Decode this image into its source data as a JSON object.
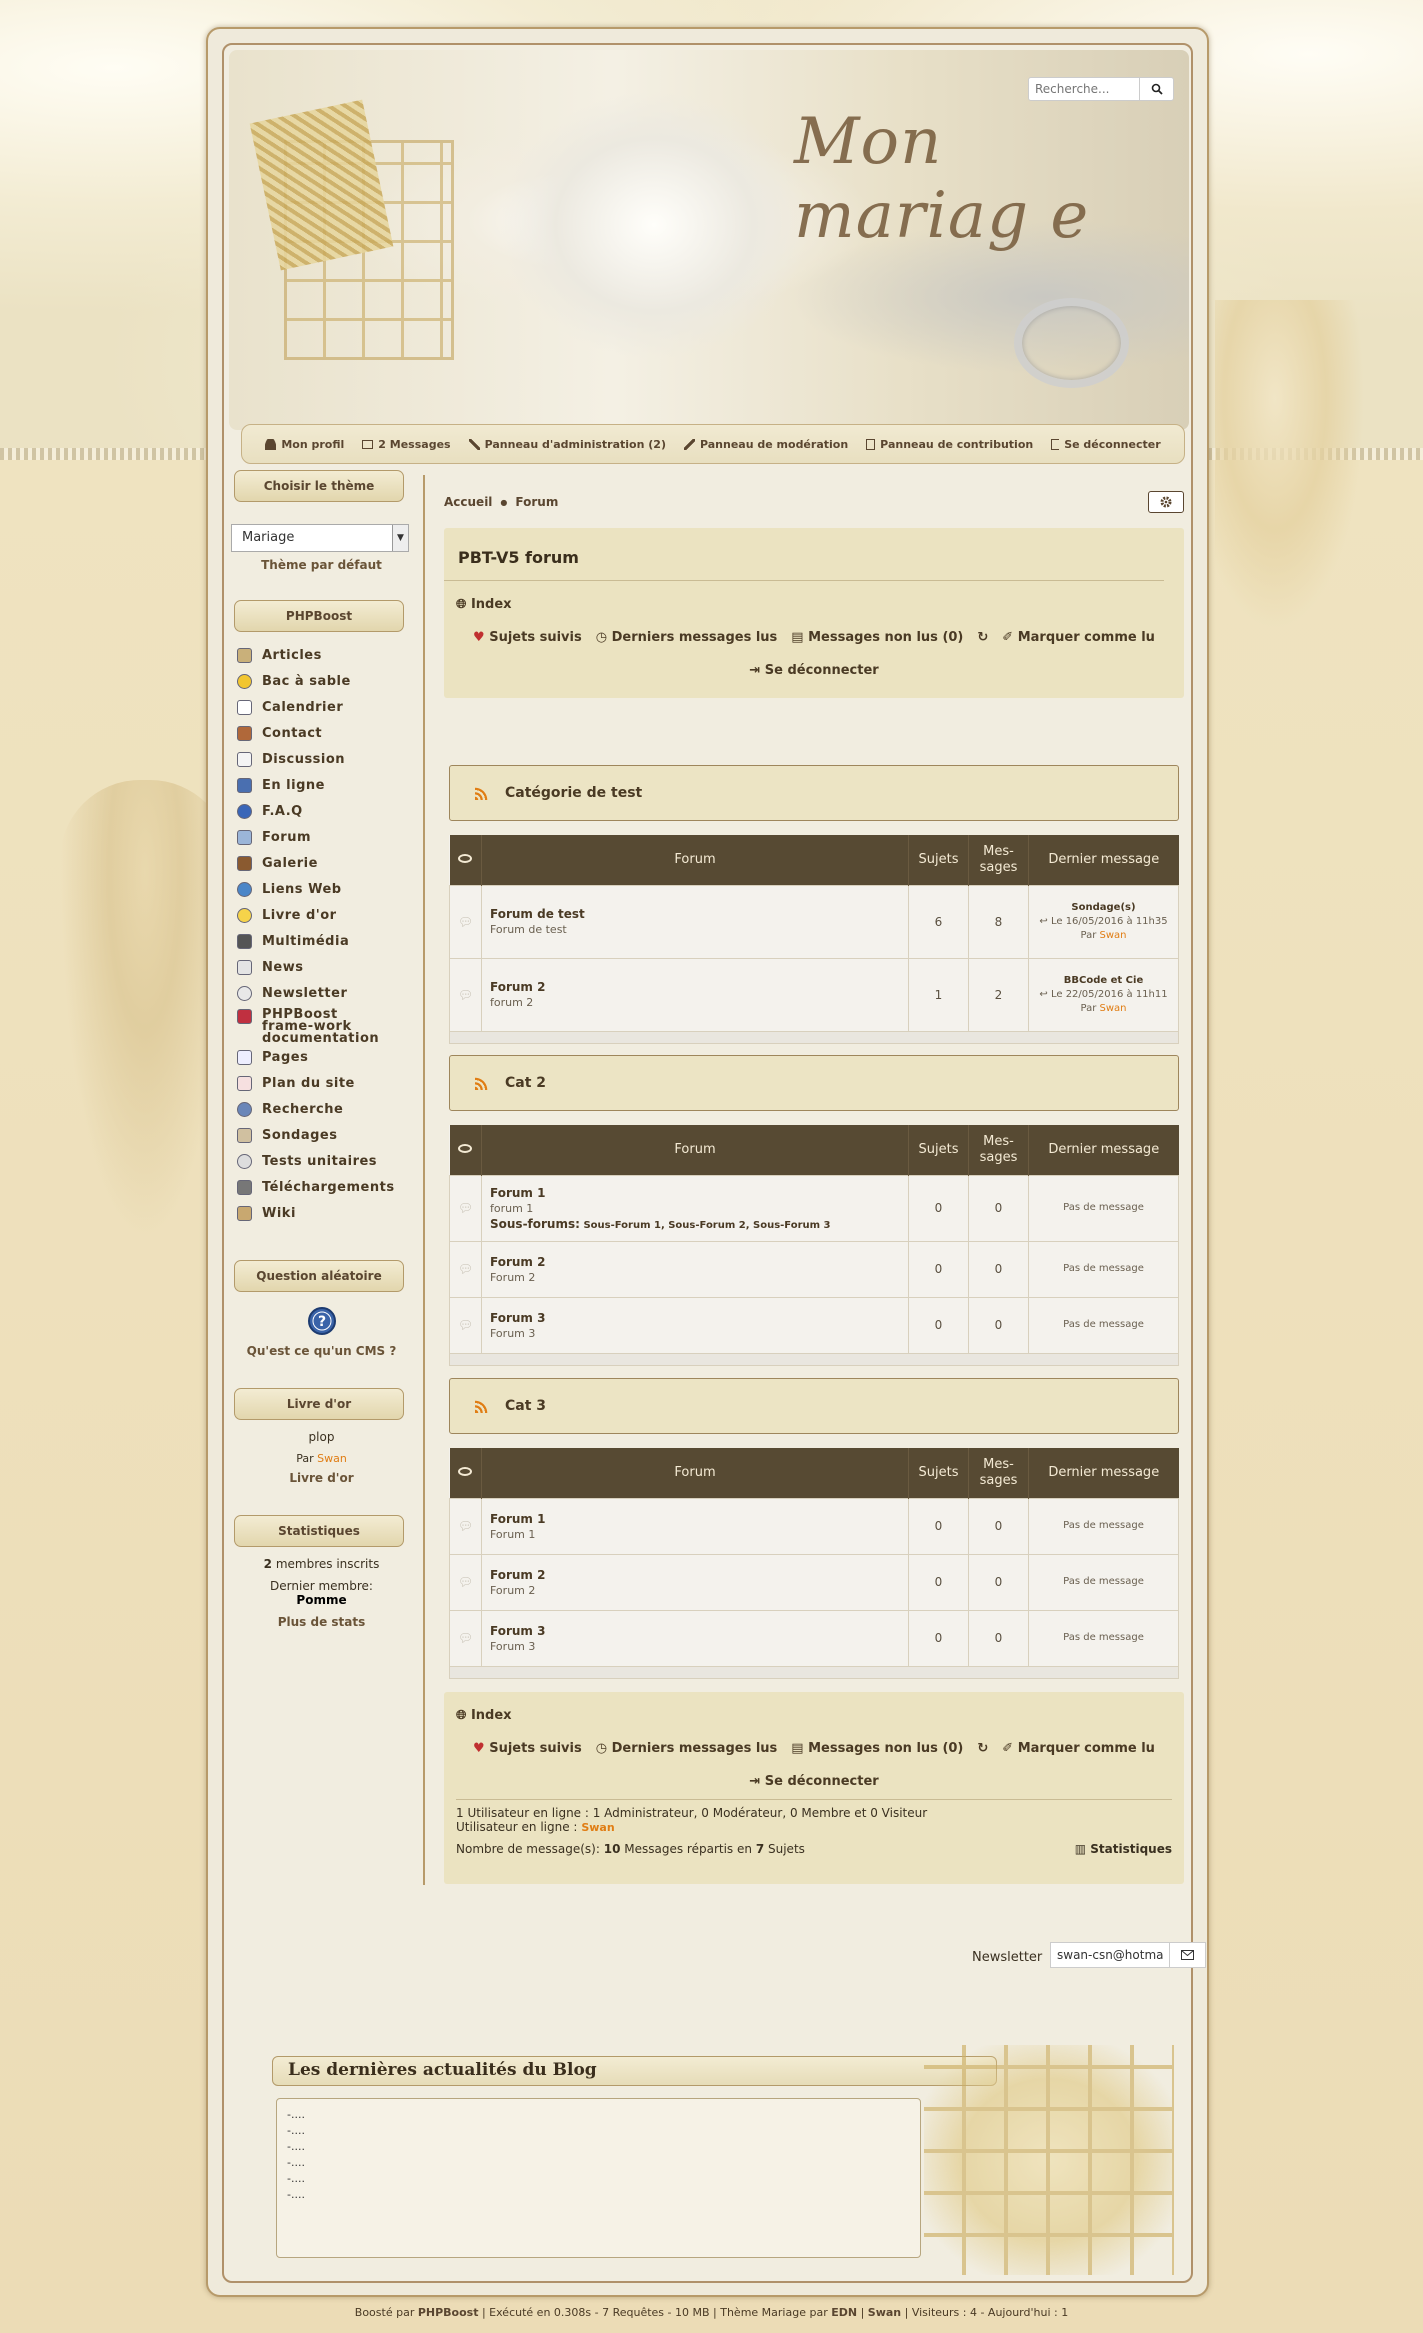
{
  "header": {
    "logo_text": "Mon mariag e",
    "search_placeholder": "Recherche..."
  },
  "userbar": [
    "Mon profil",
    "2 Messages",
    "Panneau d'administration (2)",
    "Panneau de modération",
    "Panneau de contribution",
    "Se déconnecter"
  ],
  "sidebar": {
    "theme_title": "Choisir le thème",
    "theme_selected": "Mariage",
    "theme_default": "Thème par défaut",
    "menu_title": "PHPBoost",
    "menu": [
      "Articles",
      "Bac à sable",
      "Calendrier",
      "Contact",
      "Discussion",
      "En ligne",
      "F.A.Q",
      "Forum",
      "Galerie",
      "Liens Web",
      "Livre d'or",
      "Multimédia",
      "News",
      "Newsletter",
      "PHPBoost frame-work documentation",
      "Pages",
      "Plan du site",
      "Recherche",
      "Sondages",
      "Tests unitaires",
      "Téléchargements",
      "Wiki"
    ],
    "question_title": "Question aléatoire",
    "question_text": "Qu'est ce qu'un CMS ?",
    "guestbook_title": "Livre d'or",
    "guestbook_msg": "plop",
    "guestbook_by": "Par",
    "guestbook_author": "Swan",
    "guestbook_link": "Livre d'or",
    "stats_title": "Statistiques",
    "stats_members_count": "2",
    "stats_members_label": "membres inscrits",
    "stats_last_label": "Dernier membre:",
    "stats_last_member": "Pomme",
    "stats_more": "Plus de stats"
  },
  "breadcrumb": [
    "Accueil",
    "Forum"
  ],
  "forum": {
    "title": "PBT-V5 forum",
    "index_label": "Index",
    "links": [
      "Sujets suivis",
      "Derniers messages lus",
      "Messages non lus (0)",
      "Marquer comme lu"
    ],
    "logout": "Se déconnecter",
    "col_forum": "Forum",
    "col_topics": "Sujets",
    "col_msgs_1": "Mes-",
    "col_msgs_2": "sages",
    "col_last": "Dernier message",
    "categories": [
      {
        "name": "Catégorie de test",
        "forums": [
          {
            "name": "Forum de test",
            "desc": "Forum de test",
            "topics": "6",
            "msgs": "8",
            "last_title": "Sondage(s)",
            "last_date": "Le 16/05/2016 à 11h35",
            "last_by": "Par",
            "last_user": "Swan"
          },
          {
            "name": "Forum 2",
            "desc": "forum 2",
            "topics": "1",
            "msgs": "2",
            "last_title": "BBCode et Cie",
            "last_date": "Le 22/05/2016 à 11h11",
            "last_by": "Par",
            "last_user": "Swan"
          }
        ]
      },
      {
        "name": "Cat 2",
        "forums": [
          {
            "name": "Forum 1",
            "desc": "forum 1",
            "sub_label": "Sous-forums:",
            "sub_list": "Sous-Forum 1, Sous-Forum 2, Sous-Forum 3",
            "topics": "0",
            "msgs": "0",
            "last": "Pas de message"
          },
          {
            "name": "Forum 2",
            "desc": "Forum 2",
            "topics": "0",
            "msgs": "0",
            "last": "Pas de message"
          },
          {
            "name": "Forum 3",
            "desc": "Forum 3",
            "topics": "0",
            "msgs": "0",
            "last": "Pas de message"
          }
        ]
      },
      {
        "name": "Cat 3",
        "forums": [
          {
            "name": "Forum 1",
            "desc": "Forum 1",
            "topics": "0",
            "msgs": "0",
            "last": "Pas de message"
          },
          {
            "name": "Forum 2",
            "desc": "Forum 2",
            "topics": "0",
            "msgs": "0",
            "last": "Pas de message"
          },
          {
            "name": "Forum 3",
            "desc": "Forum 3",
            "topics": "0",
            "msgs": "0",
            "last": "Pas de message"
          }
        ]
      }
    ],
    "online_line": "1 Utilisateur en ligne : 1 Administrateur, 0 Modérateur, 0 Membre et 0 Visiteur",
    "online_users_label": "Utilisateur en ligne :",
    "online_user": "Swan",
    "msgs_prefix": "Nombre de message(s):",
    "msgs_count": "10",
    "msgs_mid": "Messages répartis en",
    "topics_count": "7",
    "msgs_suffix": "Sujets",
    "stats_link": "Statistiques"
  },
  "newsletter": {
    "label": "Newsletter",
    "value": "swan-csn@hotma"
  },
  "blog": {
    "title": "Les dernières actualités du Blog",
    "items": [
      "-....",
      "-....",
      "-....",
      "-....",
      "-....",
      "-...."
    ]
  },
  "footer": {
    "powered": "Boosté par",
    "phpboost": "PHPBoost",
    "exec": "| Exécuté en 0.308s - 7 Requêtes - 10 MB |",
    "theme": "Thème Mariage par",
    "edn": "EDN",
    "swan": "Swan",
    "visitors": "| Visiteurs : 4 - Aujourd'hui : 1"
  }
}
